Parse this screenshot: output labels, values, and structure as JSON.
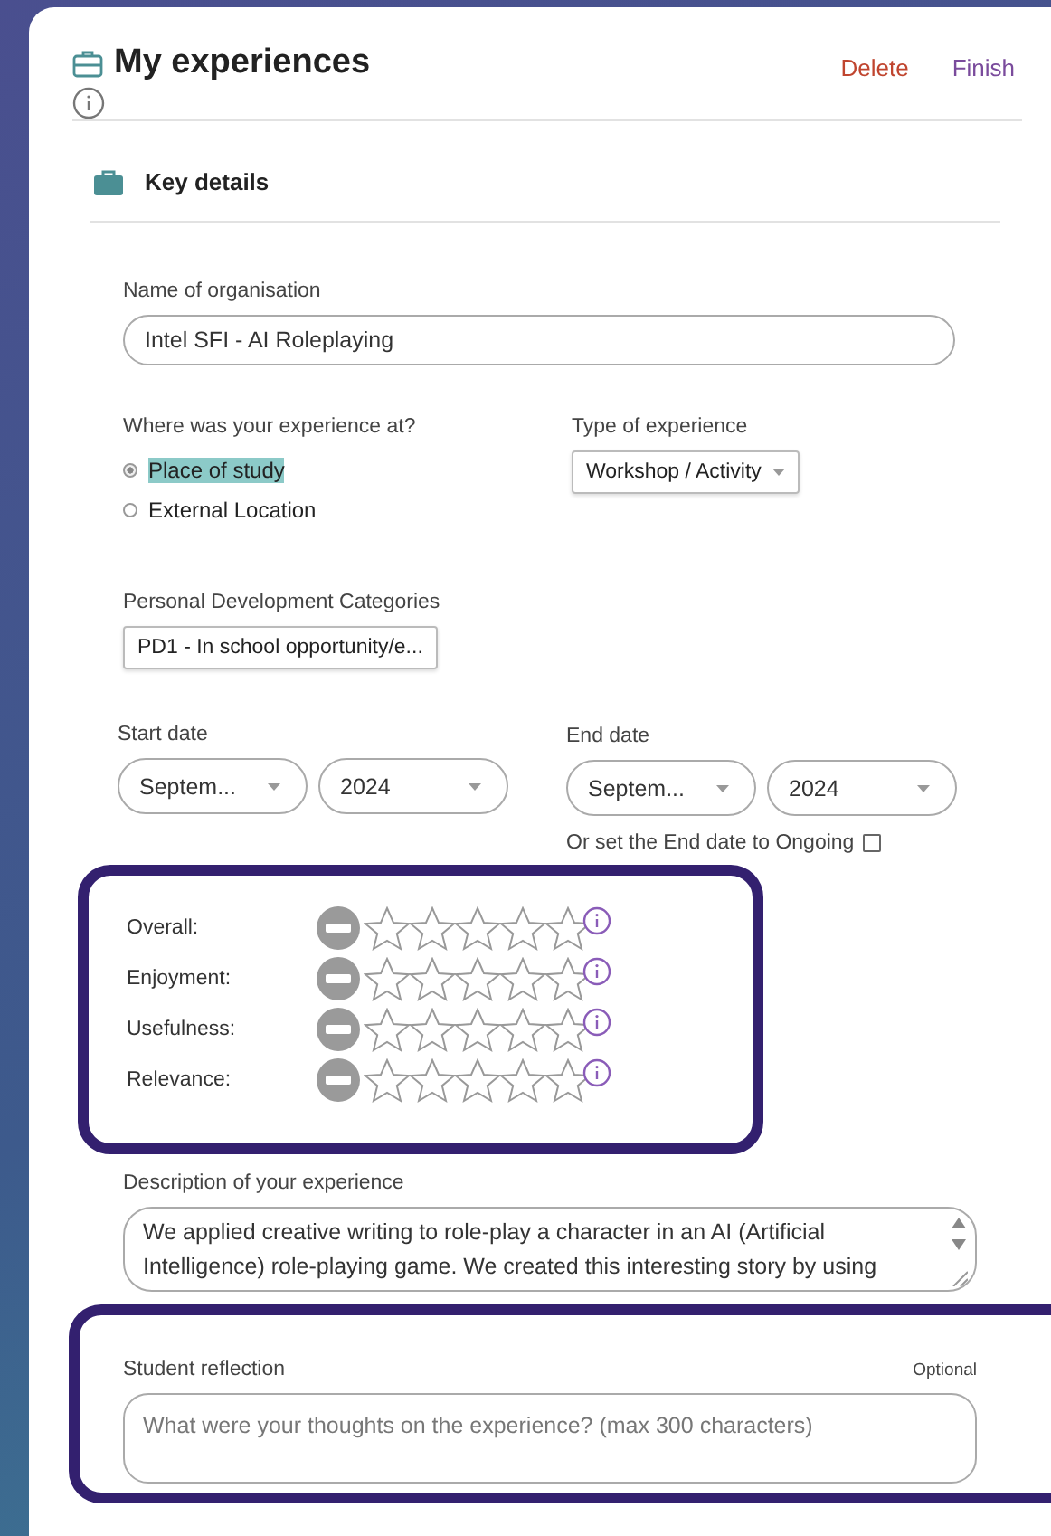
{
  "header": {
    "title": "My experiences",
    "actions": [
      {
        "label": "Delete",
        "kind": "danger"
      },
      {
        "label": "Finish",
        "kind": "primary"
      }
    ]
  },
  "section": {
    "title": "Key details"
  },
  "organisation": {
    "label": "Name of organisation",
    "value": "Intel SFI - AI Roleplaying"
  },
  "location": {
    "label": "Where was your experience at?",
    "options": [
      {
        "label": "Place of study",
        "selected": true
      },
      {
        "label": "External Location",
        "selected": false
      }
    ]
  },
  "experience_type": {
    "label": "Type of experience",
    "value": "Workshop / Activity"
  },
  "categories": {
    "label": "Personal Development Categories",
    "value": "PD1 - In school opportunity/e..."
  },
  "start_date": {
    "label": "Start date",
    "month": "Septem...",
    "year": "2024"
  },
  "end_date": {
    "label": "End date",
    "month": "Septem...",
    "year": "2024"
  },
  "ongoing": {
    "label": "Or set the End date to Ongoing",
    "checked": false
  },
  "ratings": [
    {
      "label": "Overall:",
      "stars": 0
    },
    {
      "label": "Enjoyment:",
      "stars": 0
    },
    {
      "label": "Usefulness:",
      "stars": 0
    },
    {
      "label": "Relevance:",
      "stars": 0
    }
  ],
  "description": {
    "label": "Description of your experience",
    "value": "We applied creative writing to role-play a character in an AI (Artificial Intelligence) role-playing game. We created this interesting story by using"
  },
  "reflection": {
    "label": "Student reflection",
    "optional": "Optional",
    "placeholder": "What were your thoughts on the experience? (max 300 characters)"
  }
}
